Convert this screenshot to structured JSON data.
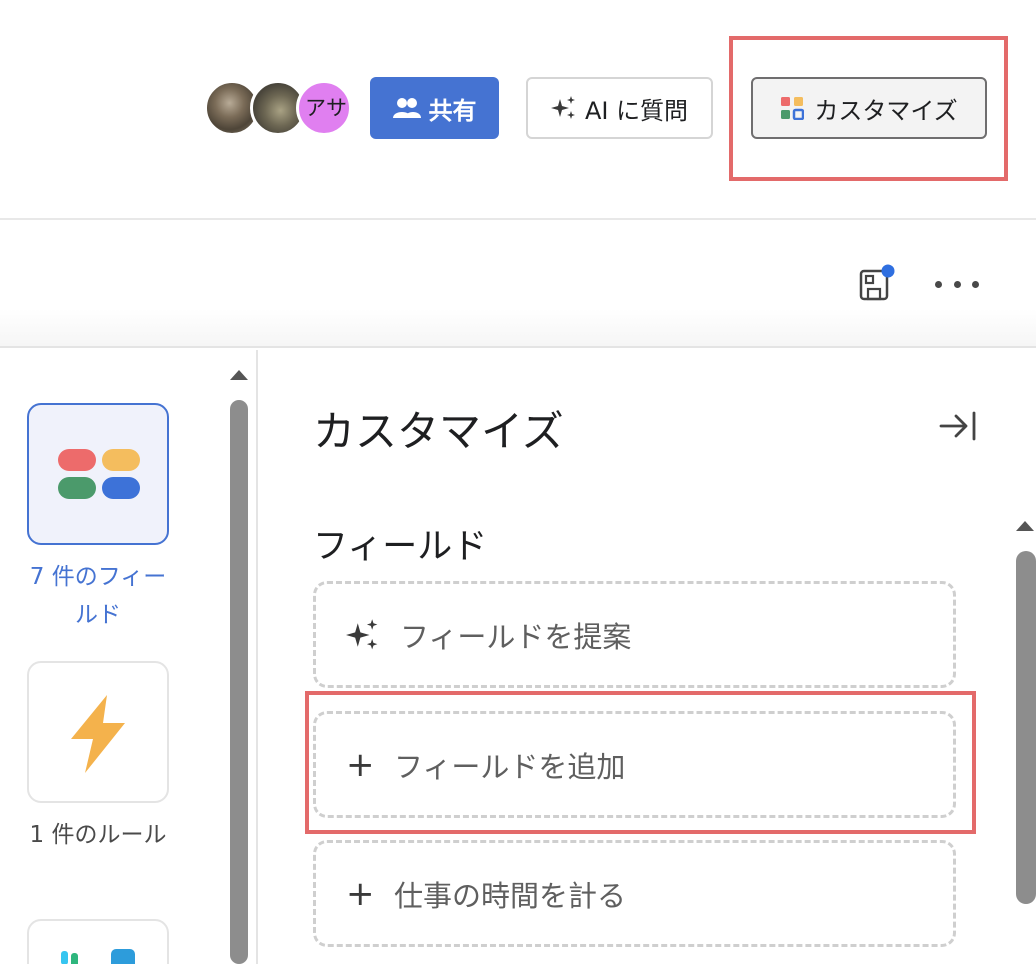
{
  "header": {
    "avatars": [
      {
        "name": "avatar-photo-1",
        "text": ""
      },
      {
        "name": "avatar-photo-2",
        "text": ""
      },
      {
        "name": "avatar-initials",
        "text": "アサ"
      }
    ],
    "share_label": "共有",
    "ai_label": "AI に質問",
    "customize_label": "カスタマイズ"
  },
  "icons": {
    "share": "people-icon",
    "ai": "sparkle-icon",
    "customize": "grid-icon",
    "save": "save-layout-icon",
    "more": "more-icon",
    "collapse": "collapse-right-icon",
    "fields_tile": "fields-icon",
    "rules_tile": "lightning-icon",
    "apps_tile": "apps-icon"
  },
  "colors": {
    "accent": "#4573d2",
    "highlight": "#e36a6a",
    "notification_dot": "#2f6fe0",
    "pill_red": "#ed6b6b",
    "pill_yellow": "#f4bd5e",
    "pill_green": "#4b9a6b",
    "pill_blue": "#3d72d8",
    "lightning": "#f4b24c"
  },
  "rail": {
    "items": [
      {
        "label": "7 件のフィールド",
        "active": true
      },
      {
        "label": "1 件のルール",
        "active": false
      },
      {
        "label": "",
        "active": false
      }
    ]
  },
  "panel": {
    "title": "カスタマイズ",
    "section_title": "フィールド",
    "cards": [
      {
        "label": "フィールドを提案",
        "icon": "sparkle-icon"
      },
      {
        "label": "フィールドを追加",
        "icon": "plus-icon"
      },
      {
        "label": "仕事の時間を計る",
        "icon": "plus-icon"
      }
    ]
  }
}
